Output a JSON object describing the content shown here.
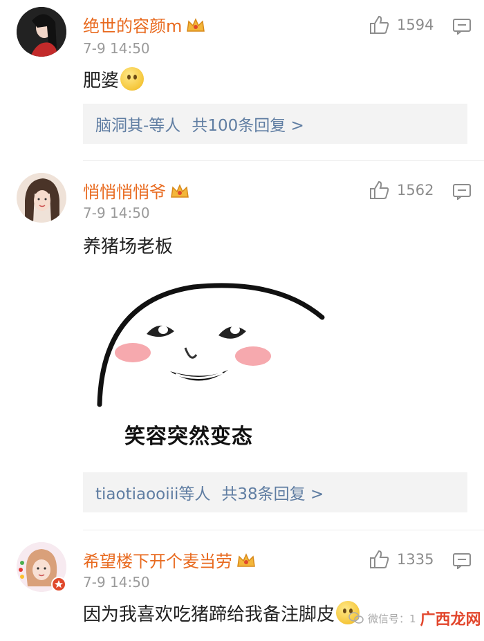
{
  "comments": [
    {
      "username": "绝世的容颜m",
      "time": "7-9 14:50",
      "text": "肥婆",
      "likes": "1594",
      "reply_names": "脑洞其-等人",
      "reply_count": "共100条回复 >"
    },
    {
      "username": "悄悄悄悄爷",
      "time": "7-9 14:50",
      "text": "养猪场老板",
      "likes": "1562",
      "meme_caption": "笑容突然变态",
      "reply_names": "tiaotiaooiii等人",
      "reply_count": "共38条回复 >"
    },
    {
      "username": "希望楼下开个麦当劳",
      "time": "7-9 14:50",
      "text": "因为我喜欢吃猪蹄给我备注脚皮",
      "likes": "1335"
    }
  ],
  "watermark": {
    "wechat_text": "微信号：1",
    "site_text": "广西龙网"
  },
  "colors": {
    "username": "#e86a1f",
    "reply_link": "#5f7da2",
    "meta": "#9a9a9a"
  }
}
